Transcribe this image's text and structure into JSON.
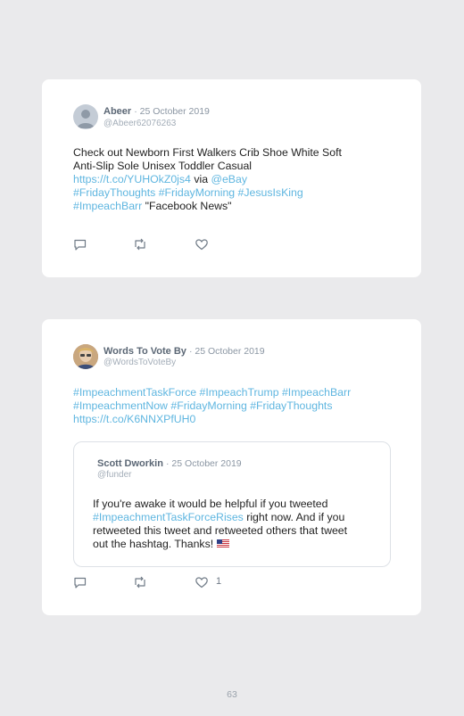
{
  "colors": {
    "link": "#5fb6e0",
    "name": "#5b6775",
    "background": "#eaeaec"
  },
  "tweets": [
    {
      "name": "Abeer",
      "date": "· 25 October 2019",
      "handle": "@Abeer62076263",
      "lines": [
        [
          {
            "t": "Check out Newborn First Walkers Crib Shoe White Soft"
          }
        ],
        [
          {
            "t": "Anti-Slip Sole Unisex Toddler Casual"
          }
        ],
        [
          {
            "t": "https://t.co/YUHOkZ0js4",
            "link": true
          },
          {
            "t": " via "
          },
          {
            "t": "@eBay",
            "link": true
          }
        ],
        [
          {
            "t": "#FridayThoughts #FridayMorning #JesusIsKing",
            "link": true
          }
        ],
        [
          {
            "t": "#ImpeachBarr",
            "link": true
          },
          {
            "t": " \"Facebook News\""
          }
        ]
      ]
    },
    {
      "name": "Words To Vote By",
      "date": "· 25 October 2019",
      "handle": "@WordsToVoteBy",
      "lines": [
        [
          {
            "t": "#ImpeachmentTaskForce #ImpeachTrump #ImpeachBarr",
            "link": true
          }
        ],
        [
          {
            "t": "#ImpeachmentNow #FridayMorning #FridayThoughts",
            "link": true
          }
        ],
        [
          {
            "t": "https://t.co/K6NNXPfUH0",
            "link": true
          }
        ]
      ],
      "likes": "1",
      "quoted": {
        "name": "Scott Dworkin",
        "date": "· 25 October 2019",
        "handle": "@funder",
        "lines": [
          [
            {
              "t": "If you're awake it would be helpful if you tweeted"
            }
          ],
          [
            {
              "t": "#ImpeachmentTaskForceRises",
              "link": true
            },
            {
              "t": " right now. And if you"
            }
          ],
          [
            {
              "t": "retweeted this tweet and retweeted others that tweet"
            }
          ],
          [
            {
              "t": "out the hashtag. Thanks! "
            },
            {
              "flag": "us-flag"
            }
          ]
        ]
      }
    }
  ],
  "page_number": "63"
}
